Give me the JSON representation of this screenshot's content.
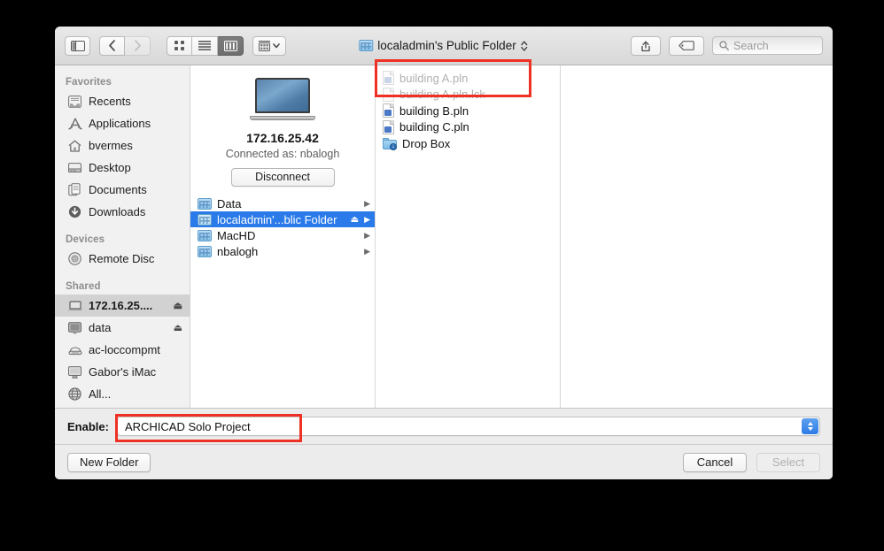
{
  "dialog": {
    "title": "localadmin's Public Folder",
    "title_icon": "network-share-folder-icon",
    "path_chevron": "chevron-up-down-icon"
  },
  "toolbar": {
    "sidebar_toggle": "sidebar-toggle-icon",
    "back": "chevron-left-icon",
    "forward": "chevron-right-icon",
    "view_icon": "icon-view-icon",
    "view_list": "list-view-icon",
    "view_column": "column-view-icon",
    "arrange": "arrange-grid-icon",
    "arrange_chevron": "chevron-down-icon",
    "share": "share-icon",
    "tag": "tag-icon",
    "search_icon": "search-icon",
    "search_placeholder": "Search",
    "search_value": ""
  },
  "sidebar": {
    "sections": [
      {
        "header": "Favorites",
        "items": [
          {
            "label": "Recents",
            "icon": "recents-icon",
            "eject": false,
            "selected": false
          },
          {
            "label": "Applications",
            "icon": "applications-icon",
            "eject": false,
            "selected": false
          },
          {
            "label": "bvermes",
            "icon": "home-icon",
            "eject": false,
            "selected": false
          },
          {
            "label": "Desktop",
            "icon": "desktop-icon",
            "eject": false,
            "selected": false
          },
          {
            "label": "Documents",
            "icon": "documents-icon",
            "eject": false,
            "selected": false
          },
          {
            "label": "Downloads",
            "icon": "downloads-icon",
            "eject": false,
            "selected": false
          }
        ]
      },
      {
        "header": "Devices",
        "items": [
          {
            "label": "Remote Disc",
            "icon": "optical-disc-icon",
            "eject": false,
            "selected": false
          }
        ]
      },
      {
        "header": "Shared",
        "items": [
          {
            "label": "172.16.25....",
            "icon": "laptop-icon",
            "eject": true,
            "selected": true
          },
          {
            "label": "data",
            "icon": "display-icon",
            "eject": true,
            "selected": false
          },
          {
            "label": "ac-loccompmt",
            "icon": "printer-icon",
            "eject": false,
            "selected": false
          },
          {
            "label": "Gabor's iMac",
            "icon": "imac-icon",
            "eject": false,
            "selected": false
          },
          {
            "label": "All...",
            "icon": "globe-icon",
            "eject": false,
            "selected": false
          }
        ]
      }
    ]
  },
  "column_server": {
    "device_icon": "laptop-icon",
    "name": "172.16.25.42",
    "connected_as": "Connected as: nbalogh",
    "disconnect_label": "Disconnect",
    "shares": [
      {
        "label": "Data",
        "icon": "network-share-folder-icon",
        "eject": false,
        "chevron": true,
        "selected": false
      },
      {
        "label": "localadmin'...blic Folder",
        "icon": "network-share-folder-icon",
        "eject": true,
        "chevron": true,
        "selected": true
      },
      {
        "label": "MacHD",
        "icon": "network-share-folder-icon",
        "eject": false,
        "chevron": true,
        "selected": false
      },
      {
        "label": "nbalogh",
        "icon": "network-share-folder-icon",
        "eject": false,
        "chevron": true,
        "selected": false
      }
    ]
  },
  "column_files": {
    "files": [
      {
        "label": "building A.pln",
        "icon": "pln-document-icon",
        "dimmed": true,
        "kind": "doc"
      },
      {
        "label": "building A.pln.lck",
        "icon": "blank-document-icon",
        "dimmed": true,
        "kind": "blank"
      },
      {
        "label": "building B.pln",
        "icon": "pln-document-icon",
        "dimmed": false,
        "kind": "doc"
      },
      {
        "label": "building C.pln",
        "icon": "pln-document-icon",
        "dimmed": false,
        "kind": "doc"
      },
      {
        "label": "Drop Box",
        "icon": "drop-box-folder-icon",
        "dimmed": false,
        "kind": "dropbox"
      }
    ]
  },
  "enable_bar": {
    "label": "Enable:",
    "value": "ARCHICAD Solo Project",
    "arrow_icon": "popup-arrows-icon"
  },
  "footer": {
    "new_folder": "New Folder",
    "cancel": "Cancel",
    "select": "Select"
  },
  "annotations": {
    "accent_color": "#ee3124",
    "files_box": "highlights greyed-out building A.pln and lock file",
    "enable_box": "highlights ARCHICAD Solo Project file filter"
  }
}
